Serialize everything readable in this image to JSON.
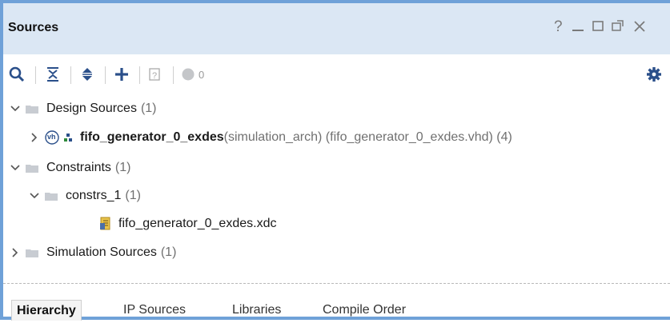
{
  "window": {
    "title": "Sources",
    "help_glyph": "?",
    "minimize_glyph": "—",
    "maximize_glyph": "☐",
    "float_glyph": "⧉",
    "close_glyph": "✕"
  },
  "toolbar": {
    "search": "search-icon",
    "collapse_all": "collapse-all-icon",
    "expand_all": "expand-all-icon",
    "add": "add-icon",
    "properties": "question-doc-icon",
    "messages_count": "0",
    "settings": "gear-icon"
  },
  "tree": {
    "design_sources": {
      "label": "Design Sources",
      "count": "(1)"
    },
    "top_module": {
      "name": "fifo_generator_0_exdes",
      "detail": "(simulation_arch) (fifo_generator_0_exdes.vhd) (4)",
      "badge": "vh"
    },
    "constraints": {
      "label": "Constraints",
      "count": "(1)"
    },
    "constrs_1": {
      "label": "constrs_1",
      "count": "(1)"
    },
    "xdc_file": {
      "label": "fifo_generator_0_exdes.xdc"
    },
    "simulation_sources": {
      "label": "Simulation Sources",
      "count": "(1)"
    }
  },
  "tabs": [
    {
      "label": "Hierarchy"
    },
    {
      "label": "IP Sources"
    },
    {
      "label": "Libraries"
    },
    {
      "label": "Compile Order"
    }
  ],
  "colors": {
    "accent": "#6fa1d8",
    "titlebar_bg": "#dbe7f4",
    "icon_blue": "#2a4f8a",
    "folder": "#c8ccd2"
  }
}
